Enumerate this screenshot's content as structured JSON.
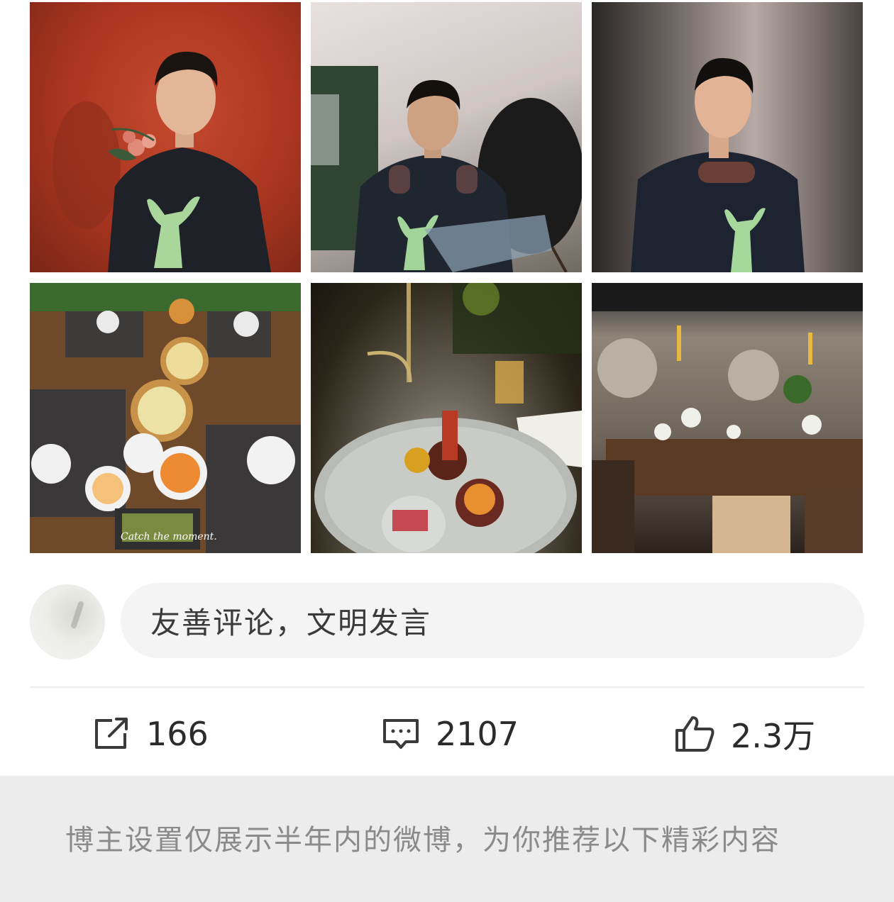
{
  "photos": [
    {
      "name": "photo-man-red-wall"
    },
    {
      "name": "photo-man-headphones-sitting"
    },
    {
      "name": "photo-man-headphones-standing"
    },
    {
      "name": "photo-breakfast-table"
    },
    {
      "name": "photo-plated-dish"
    },
    {
      "name": "photo-dining-room"
    }
  ],
  "photo_caption": "Catch the moment.",
  "comment_box": {
    "placeholder": "友善评论，文明发言"
  },
  "actions": {
    "share_count": "166",
    "comment_count": "2107",
    "like_count": "2.3万"
  },
  "notice": {
    "text": "博主设置仅展示半年内的微博，为你推荐以下精彩内容"
  },
  "colors": {
    "input_bg": "#f4f4f4",
    "notice_bg": "#ececec",
    "text_dark": "#2b2b2b",
    "text_gray": "#8a8a8a"
  }
}
